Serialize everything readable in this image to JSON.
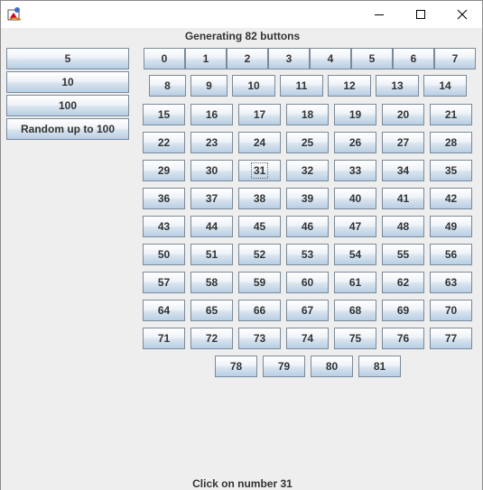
{
  "window": {
    "heading": "Generating 82 buttons",
    "status": "Click on number 31"
  },
  "sidebar": {
    "buttons": [
      "5",
      "10",
      "100",
      "Random up to 100"
    ]
  },
  "grid": {
    "numbers": [
      "0",
      "1",
      "2",
      "3",
      "4",
      "5",
      "6",
      "7",
      "8",
      "9",
      "10",
      "11",
      "12",
      "13",
      "14",
      "15",
      "16",
      "17",
      "18",
      "19",
      "20",
      "21",
      "22",
      "23",
      "24",
      "25",
      "26",
      "27",
      "28",
      "29",
      "30",
      "31",
      "32",
      "33",
      "34",
      "35",
      "36",
      "37",
      "38",
      "39",
      "40",
      "41",
      "42",
      "43",
      "44",
      "45",
      "46",
      "47",
      "48",
      "49",
      "50",
      "51",
      "52",
      "53",
      "54",
      "55",
      "56",
      "57",
      "58",
      "59",
      "60",
      "61",
      "62",
      "63",
      "64",
      "65",
      "66",
      "67",
      "68",
      "69",
      "70",
      "71",
      "72",
      "73",
      "74",
      "75",
      "76",
      "77",
      "78",
      "79",
      "80",
      "81"
    ],
    "focused": "31"
  }
}
